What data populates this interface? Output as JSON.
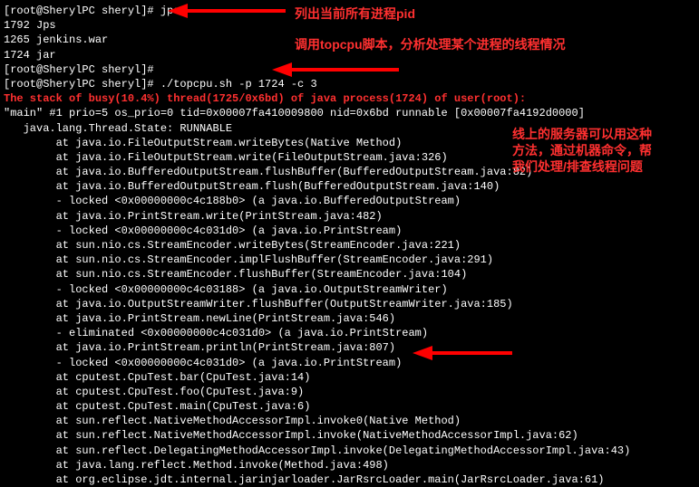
{
  "term": {
    "line1": "[root@SherylPC sheryl]# jps",
    "line2": "1792 Jps",
    "line3": "1265 jenkins.war",
    "line4": "1724 jar",
    "line5": "[root@SherylPC sheryl]#",
    "line6": "[root@SherylPC sheryl]# ./topcpu.sh -p 1724 -c 3",
    "busyline": "The stack of busy(10.4%) thread(1725/0x6bd) of java process(1724) of user(root):",
    "thread_main": "\"main\" #1 prio=5 os_prio=0 tid=0x00007fa410009800 nid=0x6bd runnable [0x00007fa4192d0000]",
    "state": "   java.lang.Thread.State: RUNNABLE",
    "stack": [
      "        at java.io.FileOutputStream.writeBytes(Native Method)",
      "        at java.io.FileOutputStream.write(FileOutputStream.java:326)",
      "        at java.io.BufferedOutputStream.flushBuffer(BufferedOutputStream.java:82)",
      "        at java.io.BufferedOutputStream.flush(BufferedOutputStream.java:140)",
      "        - locked <0x00000000c4c188b0> (a java.io.BufferedOutputStream)",
      "        at java.io.PrintStream.write(PrintStream.java:482)",
      "        - locked <0x00000000c4c031d0> (a java.io.PrintStream)",
      "        at sun.nio.cs.StreamEncoder.writeBytes(StreamEncoder.java:221)",
      "        at sun.nio.cs.StreamEncoder.implFlushBuffer(StreamEncoder.java:291)",
      "        at sun.nio.cs.StreamEncoder.flushBuffer(StreamEncoder.java:104)",
      "        - locked <0x00000000c4c03188> (a java.io.OutputStreamWriter)",
      "        at java.io.OutputStreamWriter.flushBuffer(OutputStreamWriter.java:185)",
      "        at java.io.PrintStream.newLine(PrintStream.java:546)",
      "        - eliminated <0x00000000c4c031d0> (a java.io.PrintStream)",
      "        at java.io.PrintStream.println(PrintStream.java:807)",
      "        - locked <0x00000000c4c031d0> (a java.io.PrintStream)",
      "        at cputest.CpuTest.bar(CpuTest.java:14)",
      "        at cputest.CpuTest.foo(CpuTest.java:9)",
      "        at cputest.CpuTest.main(CpuTest.java:6)",
      "        at sun.reflect.NativeMethodAccessorImpl.invoke0(Native Method)",
      "        at sun.reflect.NativeMethodAccessorImpl.invoke(NativeMethodAccessorImpl.java:62)",
      "        at sun.reflect.DelegatingMethodAccessorImpl.invoke(DelegatingMethodAccessorImpl.java:43)",
      "        at java.lang.reflect.Method.invoke(Method.java:498)",
      "        at org.eclipse.jdt.internal.jarinjarloader.JarRsrcLoader.main(JarRsrcLoader.java:61)"
    ]
  },
  "annotations": {
    "a1": "列出当前所有进程pid",
    "a2": "调用topcpu脚本，分析处理某个进程的线程情况",
    "a3_1": "线上的服务器可以用这种",
    "a3_2": "方法，通过机器命令，帮",
    "a3_3": "我们处理/排查线程问题"
  }
}
